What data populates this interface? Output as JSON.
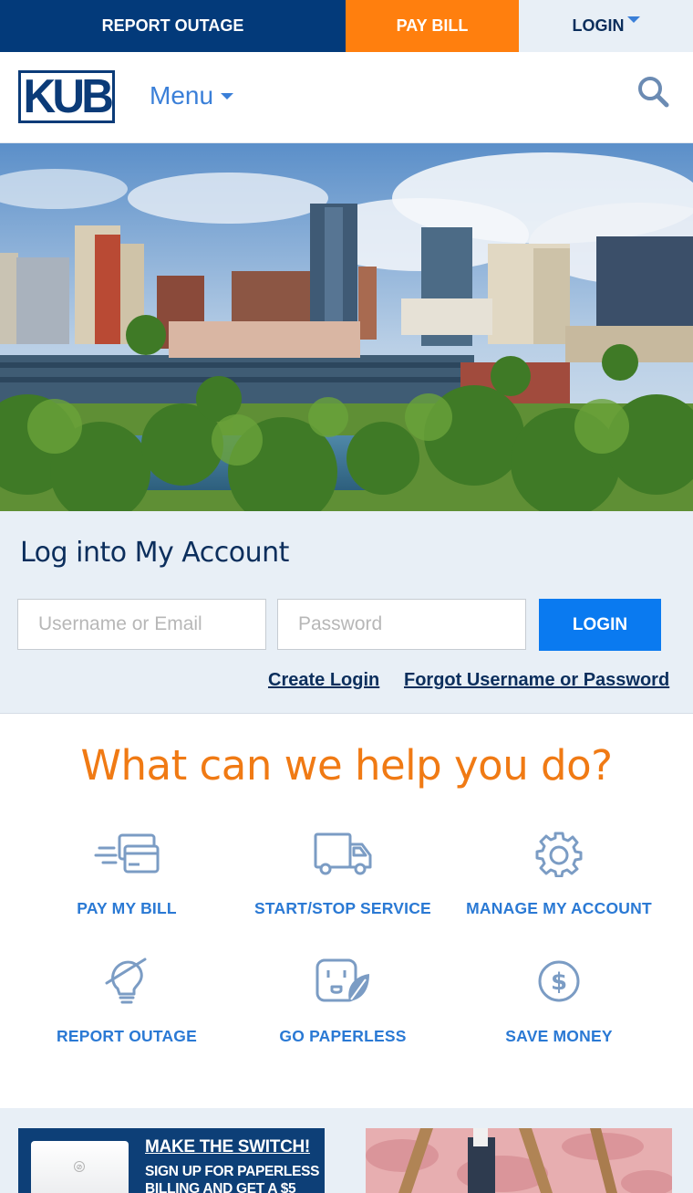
{
  "topbar": {
    "report_outage": "REPORT OUTAGE",
    "pay_bill": "PAY BILL",
    "login": "LOGIN"
  },
  "header": {
    "logo_text": "KUB",
    "menu_label": "Menu"
  },
  "login": {
    "title": "Log into My Account",
    "username_placeholder": "Username or Email",
    "password_placeholder": "Password",
    "button_label": "LOGIN",
    "create_login": "Create Login",
    "forgot": "Forgot Username or Password"
  },
  "help": {
    "title": "What can we help you do?",
    "tiles": [
      {
        "label": "PAY MY BILL",
        "icon": "credit-card-icon"
      },
      {
        "label": "START/STOP SERVICE",
        "icon": "truck-icon"
      },
      {
        "label": "MANAGE MY ACCOUNT",
        "icon": "gear-icon"
      },
      {
        "label": "REPORT OUTAGE",
        "icon": "lightbulb-off-icon"
      },
      {
        "label": "GO PAPERLESS",
        "icon": "outlet-leaf-icon"
      },
      {
        "label": "SAVE MONEY",
        "icon": "dollar-circle-icon"
      }
    ]
  },
  "promos": {
    "switch_heading": "MAKE THE SWITCH!",
    "switch_text": "SIGN UP FOR PAPERLESS BILLING AND GET A $5"
  },
  "colors": {
    "navy": "#033a7a",
    "orange": "#ff7f0e",
    "light_bg": "#e8eff6",
    "link_blue": "#2a79d4",
    "button_blue": "#0a7af0",
    "headline_orange": "#f07a14"
  }
}
